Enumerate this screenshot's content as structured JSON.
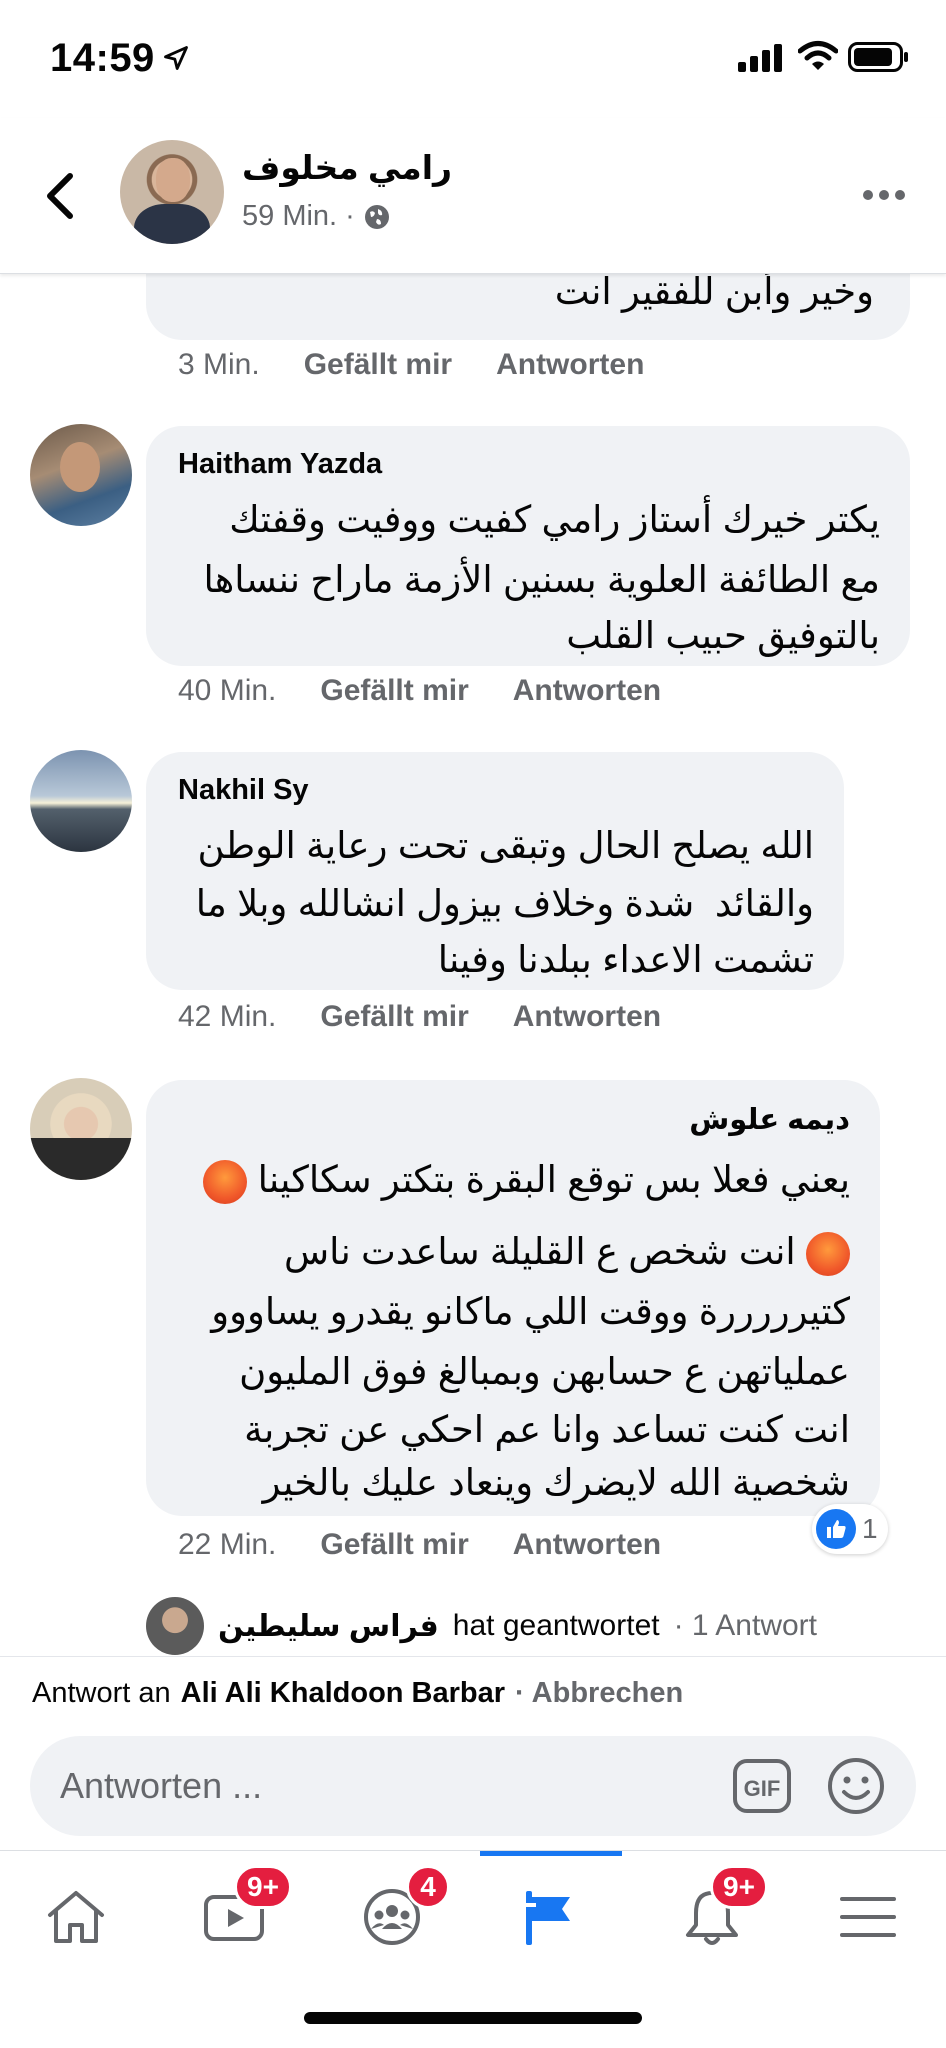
{
  "status_bar": {
    "time": "14:59"
  },
  "header": {
    "name": "رامي مخلوف",
    "time": "59 Min.",
    "separator": "·"
  },
  "comments": [
    {
      "author": "",
      "lines": [
        "وخير وأبن للفقير انت"
      ],
      "time": "3 Min.",
      "like_label": "Gefällt mir",
      "reply_label": "Antworten"
    },
    {
      "author": "Haitham Yazda",
      "lines": [
        "يكتر خيرك أستاز رامي كفيت ووفيت وقفتك",
        "مع الطائفة العلوية بسنين الأزمة ماراح ننساها",
        "بالتوفيق حبيب القلب"
      ],
      "time": "40 Min.",
      "like_label": "Gefällt mir",
      "reply_label": "Antworten"
    },
    {
      "author": "Nakhil Sy",
      "lines": [
        "الله يصلح الحال وتبقى تحت رعاية الوطن",
        "والقائد  شدة وخلاف بيزول انشالله وبلا ما",
        "تشمت الاعداء ببلدنا وفينا"
      ],
      "time": "42 Min.",
      "like_label": "Gefällt mir",
      "reply_label": "Antworten"
    },
    {
      "author": "ديمه علوش",
      "lines": [
        "يعني فعلا بس توقع البقرة بتكتر سكاكينا",
        "انت شخص ع القليلة ساعدت ناس",
        "كتيرررررة ووقت اللي ماكانو يقدرو يساووو",
        "عملياتهن ع حسابهن وبمبالغ فوق المليون",
        "انت كنت تساعد وانا عم احكي عن تجربة",
        "شخصية الله لايضرك وينعاد عليك بالخير"
      ],
      "time": "22 Min.",
      "like_label": "Gefällt mir",
      "reply_label": "Antworten",
      "reaction_count": "1"
    }
  ],
  "reply_row": {
    "name": "فراس سليطين",
    "text": "hat geantwortet",
    "count": "· 1 Antwort"
  },
  "reply_banner": {
    "prefix": "Antwort an",
    "target": "Ali Ali Khaldoon Barbar",
    "cancel": "· Abbrechen"
  },
  "composer": {
    "placeholder": "Antworten ...",
    "gif_label": "GIF"
  },
  "nav": {
    "video_badge": "9+",
    "groups_badge": "4",
    "notifications_badge": "9+"
  },
  "colors": {
    "accent": "#1877f2",
    "badge": "#e41e3f",
    "bubble": "#f0f2f5",
    "secondary_text": "#65676b"
  }
}
